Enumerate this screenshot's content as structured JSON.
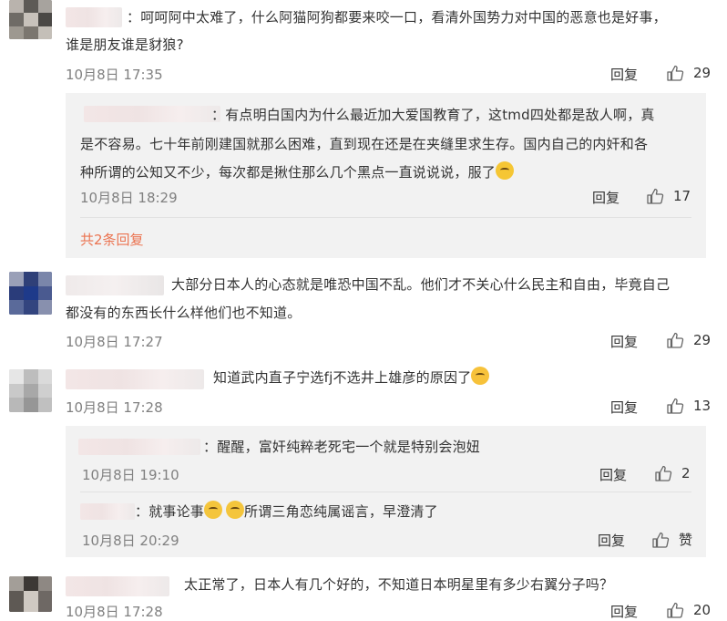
{
  "comments": [
    {
      "text": "：呵呵阿中太难了，什么阿猫阿狗都要来咬一口，看清外国势力对中国的恶意也是好事，谁是朋友谁是豺狼？",
      "line1": "：呵呵阿中太难了，什么阿猫阿狗都要来咬一口，看清外国势力对中国的恶意也是好事，",
      "line2": "谁是朋友谁是豺狼?",
      "time": "10月8日 17:35",
      "reply_label": "回复",
      "likes": "29",
      "subreplies": [
        {
          "line1": "：有点明白国内为什么最近加大爱国教育了，这tmd四处都是敌人啊，真",
          "line2": "是不容易。七十年前刚建国就那么困难，直到现在还是在夹缝里求生存。国内自己的内奸和各",
          "line3": "种所谓的公知又不少，每次都是揪住那么几个黑点一直说说说，服了",
          "time": "10月8日 18:29",
          "reply_label": "回复",
          "likes": "17"
        }
      ],
      "more_replies": "共2条回复"
    },
    {
      "line1": "大部分日本人的心态就是唯恐中国不乱。他们才不关心什么民主和自由，毕竟自己",
      "line2": "都没有的东西长什么样他们也不知道。",
      "time": "10月8日 17:27",
      "reply_label": "回复",
      "likes": "29"
    },
    {
      "line1": "知道武内直子宁选fj不选井上雄彦的原因了",
      "time": "10月8日 17:28",
      "reply_label": "回复",
      "likes": "13",
      "subreplies": [
        {
          "line1": "：醒醒，富奸纯粹老死宅一个就是特别会泡妞",
          "time": "10月8日 19:10",
          "reply_label": "回复",
          "likes": "2"
        },
        {
          "line1a": "：就事论事",
          "line1b": "所谓三角恋纯属谣言，早澄清了",
          "time": "10月8日 20:29",
          "reply_label": "回复",
          "likes": "赞"
        }
      ]
    },
    {
      "line1": "太正常了，日本人有几个好的，不知道日本明星里有多少右翼分子吗？",
      "time": "10月8日 17:28",
      "reply_label": "回复",
      "likes": "20"
    }
  ],
  "colors": {
    "link": "#eb7350",
    "muted": "#808080",
    "subbox": "#f2f2f2",
    "text": "#333333"
  },
  "icons": {
    "like": "thumbs-up-icon",
    "emoji_hug": "hugging-emoji-icon",
    "emoji_yum": "yum-emoji-icon",
    "emoji_cry": "crying-emoji-icon"
  }
}
